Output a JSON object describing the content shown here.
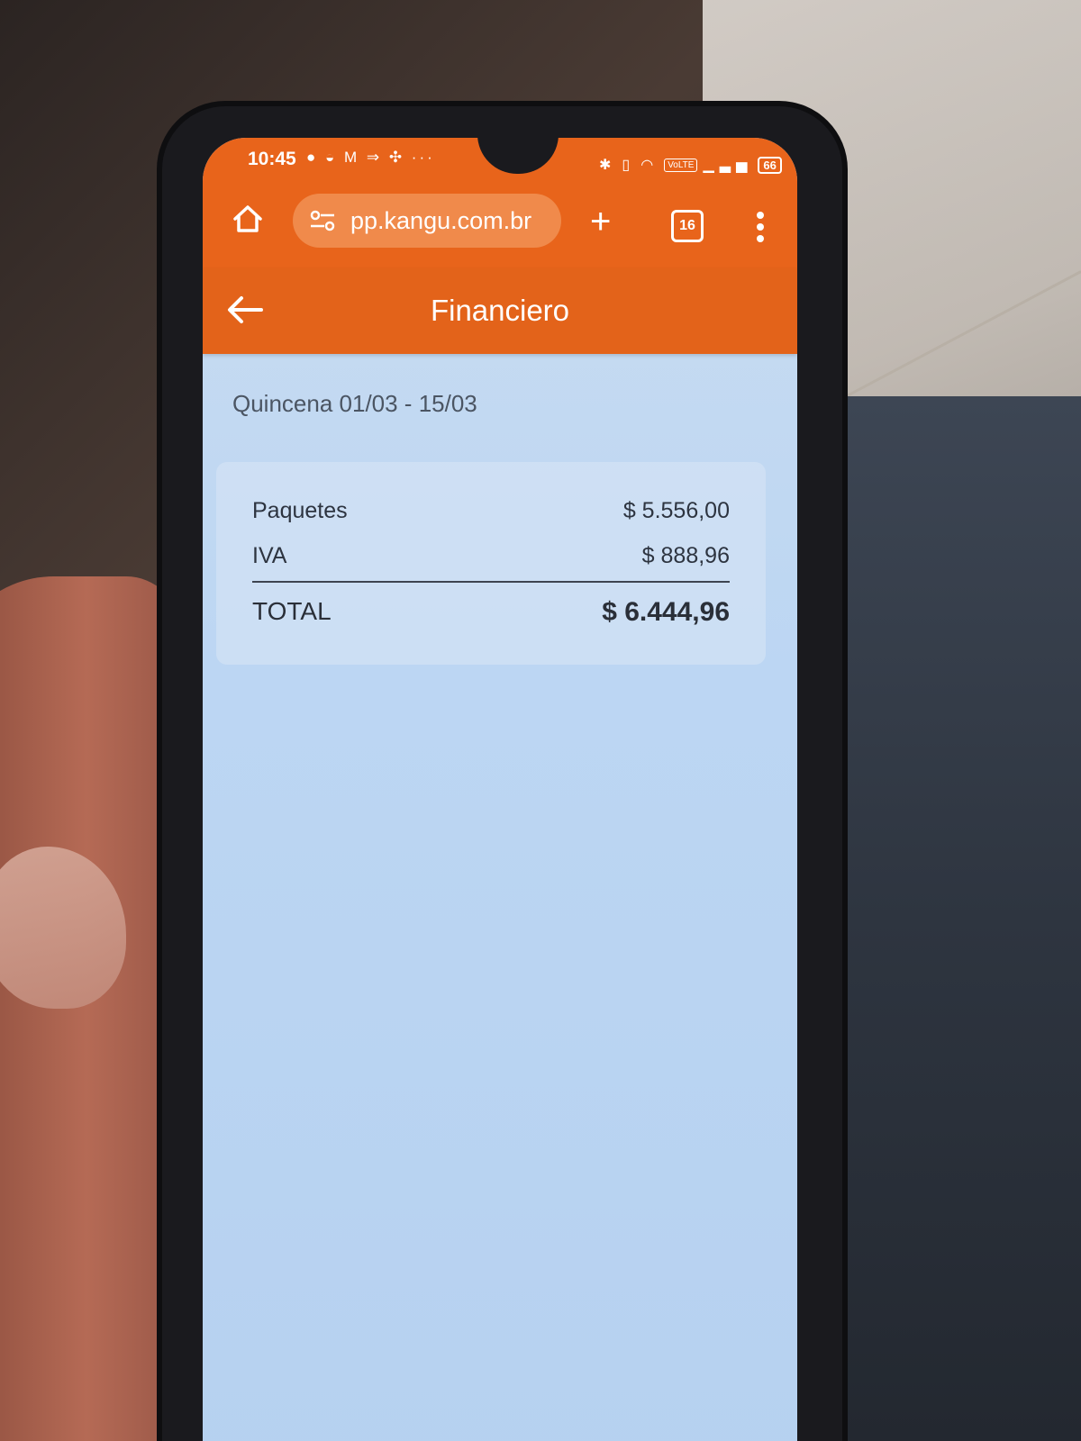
{
  "status_bar": {
    "time": "10:45",
    "left_icons": "● ◒ M ⇒ ✣ ···",
    "volte_badge": "VoLTE",
    "battery_level": "66"
  },
  "browser": {
    "url": "pp.kangu.com.br",
    "tab_count": "16",
    "accent_color": "#e8641b"
  },
  "app_header": {
    "title": "Financiero"
  },
  "period": {
    "label": "Quincena 01/03 - 15/03"
  },
  "summary": {
    "rows": [
      {
        "label": "Paquetes",
        "value": "$ 5.556,00"
      },
      {
        "label": "IVA",
        "value": "$ 888,96"
      }
    ],
    "total": {
      "label": "TOTAL",
      "value": "$ 6.444,96"
    }
  }
}
